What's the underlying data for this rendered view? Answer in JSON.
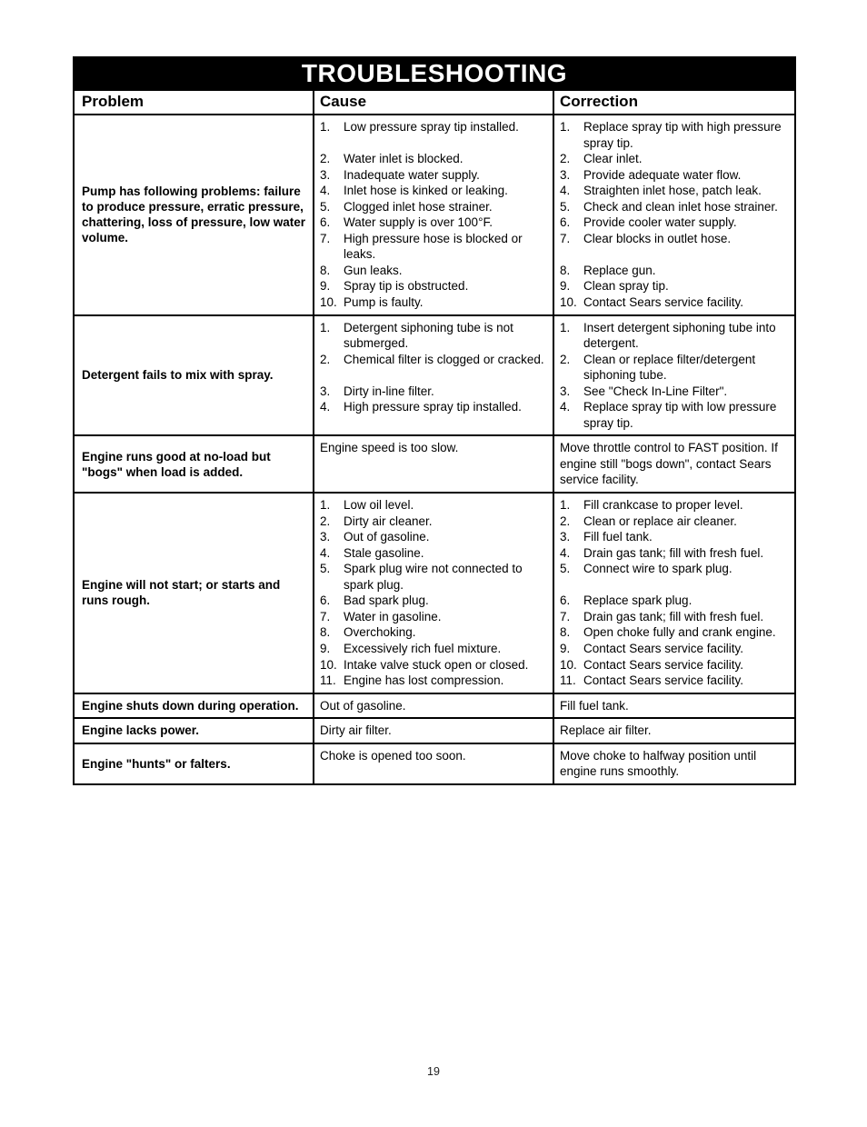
{
  "document": {
    "title": "TROUBLESHOOTING",
    "page_number": "19",
    "accent_color": "#000000",
    "background_color": "#ffffff"
  },
  "table": {
    "headers": {
      "problem": "Problem",
      "cause": "Cause",
      "correction": "Correction"
    },
    "sections": [
      {
        "problem": "Pump has following problems: failure to produce pressure, erratic pressure, chattering, loss of pressure, low water volume.",
        "items": [
          {
            "num": "1.",
            "cause": "Low pressure spray tip installed.",
            "correction": "Replace spray tip with high pressure spray tip."
          },
          {
            "num": "2.",
            "cause": "Water inlet is blocked.",
            "correction": "Clear inlet."
          },
          {
            "num": "3.",
            "cause": "Inadequate water supply.",
            "correction": "Provide adequate water flow."
          },
          {
            "num": "4.",
            "cause": "Inlet hose is kinked or leaking.",
            "correction": "Straighten inlet hose, patch leak."
          },
          {
            "num": "5.",
            "cause": "Clogged inlet hose strainer.",
            "correction": "Check and clean inlet hose strainer."
          },
          {
            "num": "6.",
            "cause": "Water supply is over 100°F.",
            "correction": "Provide cooler water supply."
          },
          {
            "num": "7.",
            "cause": "High pressure hose is blocked or leaks.",
            "correction": "Clear blocks in outlet hose."
          },
          {
            "num": "8.",
            "cause": "Gun leaks.",
            "correction": "Replace gun."
          },
          {
            "num": "9.",
            "cause": "Spray tip is obstructed.",
            "correction": "Clean spray tip."
          },
          {
            "num": "10.",
            "cause": "Pump is faulty.",
            "correction": "Contact Sears service facility."
          }
        ]
      },
      {
        "problem": "Detergent fails to mix with spray.",
        "items": [
          {
            "num": "1.",
            "cause": "Detergent siphoning tube is not submerged.",
            "correction": "Insert detergent siphoning tube into detergent."
          },
          {
            "num": "2.",
            "cause": "Chemical filter is clogged or cracked.",
            "correction": "Clean or replace filter/detergent siphoning tube."
          },
          {
            "num": "3.",
            "cause": "Dirty in-line filter.",
            "correction": "See \"Check In-Line Filter\"."
          },
          {
            "num": "4.",
            "cause": "High pressure spray tip installed.",
            "correction": "Replace spray tip with low pressure spray tip."
          }
        ]
      },
      {
        "problem": "Engine runs good at no-load but \"bogs\" when load is added.",
        "plain_cause": "Engine speed is too slow.",
        "plain_correction": "Move throttle control to FAST position. If engine still \"bogs down\", contact Sears service facility.",
        "items": []
      },
      {
        "problem": "Engine will not start; or starts and runs rough.",
        "items": [
          {
            "num": "1.",
            "cause": "Low oil level.",
            "correction": "Fill crankcase to proper level."
          },
          {
            "num": "2.",
            "cause": "Dirty air cleaner.",
            "correction": "Clean or replace air cleaner."
          },
          {
            "num": "3.",
            "cause": "Out of gasoline.",
            "correction": "Fill fuel tank."
          },
          {
            "num": "4.",
            "cause": "Stale gasoline.",
            "correction": "Drain gas tank; fill with fresh fuel."
          },
          {
            "num": "5.",
            "cause": "Spark plug wire not connected to spark plug.",
            "correction": "Connect wire to spark plug."
          },
          {
            "num": "6.",
            "cause": "Bad spark plug.",
            "correction": "Replace spark plug."
          },
          {
            "num": "7.",
            "cause": "Water in gasoline.",
            "correction": "Drain gas tank; fill with fresh fuel."
          },
          {
            "num": "8.",
            "cause": "Overchoking.",
            "correction": "Open choke fully and crank engine."
          },
          {
            "num": "9.",
            "cause": "Excessively rich fuel mixture.",
            "correction": "Contact Sears service facility."
          },
          {
            "num": "10.",
            "cause": "Intake valve stuck open or closed.",
            "correction": "Contact Sears service facility."
          },
          {
            "num": "11.",
            "cause": "Engine has lost compression.",
            "correction": "Contact Sears service facility."
          }
        ]
      },
      {
        "problem": "Engine shuts down during operation.",
        "plain_cause": "Out of gasoline.",
        "plain_correction": "Fill fuel tank.",
        "items": []
      },
      {
        "problem": "Engine lacks power.",
        "plain_cause": "Dirty air filter.",
        "plain_correction": "Replace air filter.",
        "items": []
      },
      {
        "problem": "Engine \"hunts\" or falters.",
        "plain_cause": "Choke is opened too soon.",
        "plain_correction": "Move choke to halfway position until engine runs smoothly.",
        "items": []
      }
    ]
  }
}
